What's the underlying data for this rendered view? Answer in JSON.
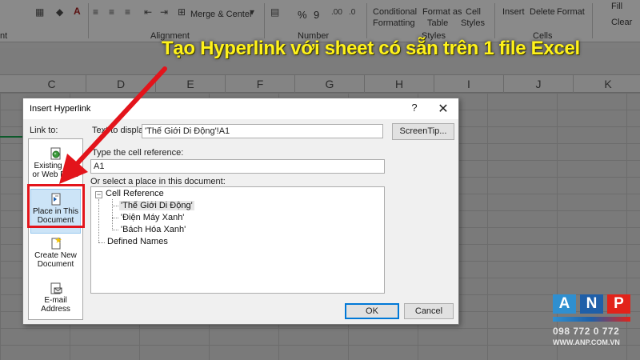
{
  "ribbon": {
    "merge_label": "Merge & Center",
    "percent_symbol": "%",
    "comma_symbol": "9",
    "conditional_formatting": [
      "Conditional",
      "Formatting"
    ],
    "format_as_table": [
      "Format as",
      "Table"
    ],
    "cell_styles": [
      "Cell",
      "Styles"
    ],
    "insert": "Insert",
    "delete": "Delete",
    "format": "Format",
    "fill": "Fill",
    "clear": "Clear",
    "groups": {
      "font": "nt",
      "alignment": "Alignment",
      "number": "Number",
      "styles": "Styles",
      "cells": "Cells"
    }
  },
  "columns": [
    "C",
    "D",
    "E",
    "F",
    "G",
    "H",
    "I",
    "J",
    "K"
  ],
  "overlay_title": "Tạo Hyperlink với sheet có sẵn trên 1 file Excel",
  "dialog": {
    "title": "Insert Hyperlink",
    "help": "?",
    "close": "✕",
    "link_to_label": "Link to:",
    "link_to_items": [
      {
        "label1": "Existing File",
        "label2": "or Web Page"
      },
      {
        "label1": "Place in This",
        "label2": "Document"
      },
      {
        "label1": "Create New",
        "label2": "Document"
      },
      {
        "label1": "E-mail",
        "label2": "Address"
      }
    ],
    "text_to_display_label": "Text to display:",
    "text_to_display_value": "'Thế Giới Di Động'!A1",
    "screentip_button": "ScreenTip...",
    "cell_ref_label": "Type the cell reference:",
    "cell_ref_value": "A1",
    "place_label": "Or select a place in this document:",
    "tree": {
      "cell_reference": "Cell Reference",
      "sheets": [
        "'Thế Giới Di Động'",
        "'Điện Máy Xanh'",
        "'Bách Hóa Xanh'"
      ],
      "defined_names": "Defined Names",
      "expander": "−"
    },
    "ok_button": "OK",
    "cancel_button": "Cancel"
  },
  "logo": {
    "letters": [
      "A",
      "N",
      "P"
    ],
    "phone": "098 772 0 772",
    "website": "WWW.ANP.COM.VN",
    "colors": [
      "#2f8fd0",
      "#1f5fa8",
      "#e2231a"
    ]
  }
}
